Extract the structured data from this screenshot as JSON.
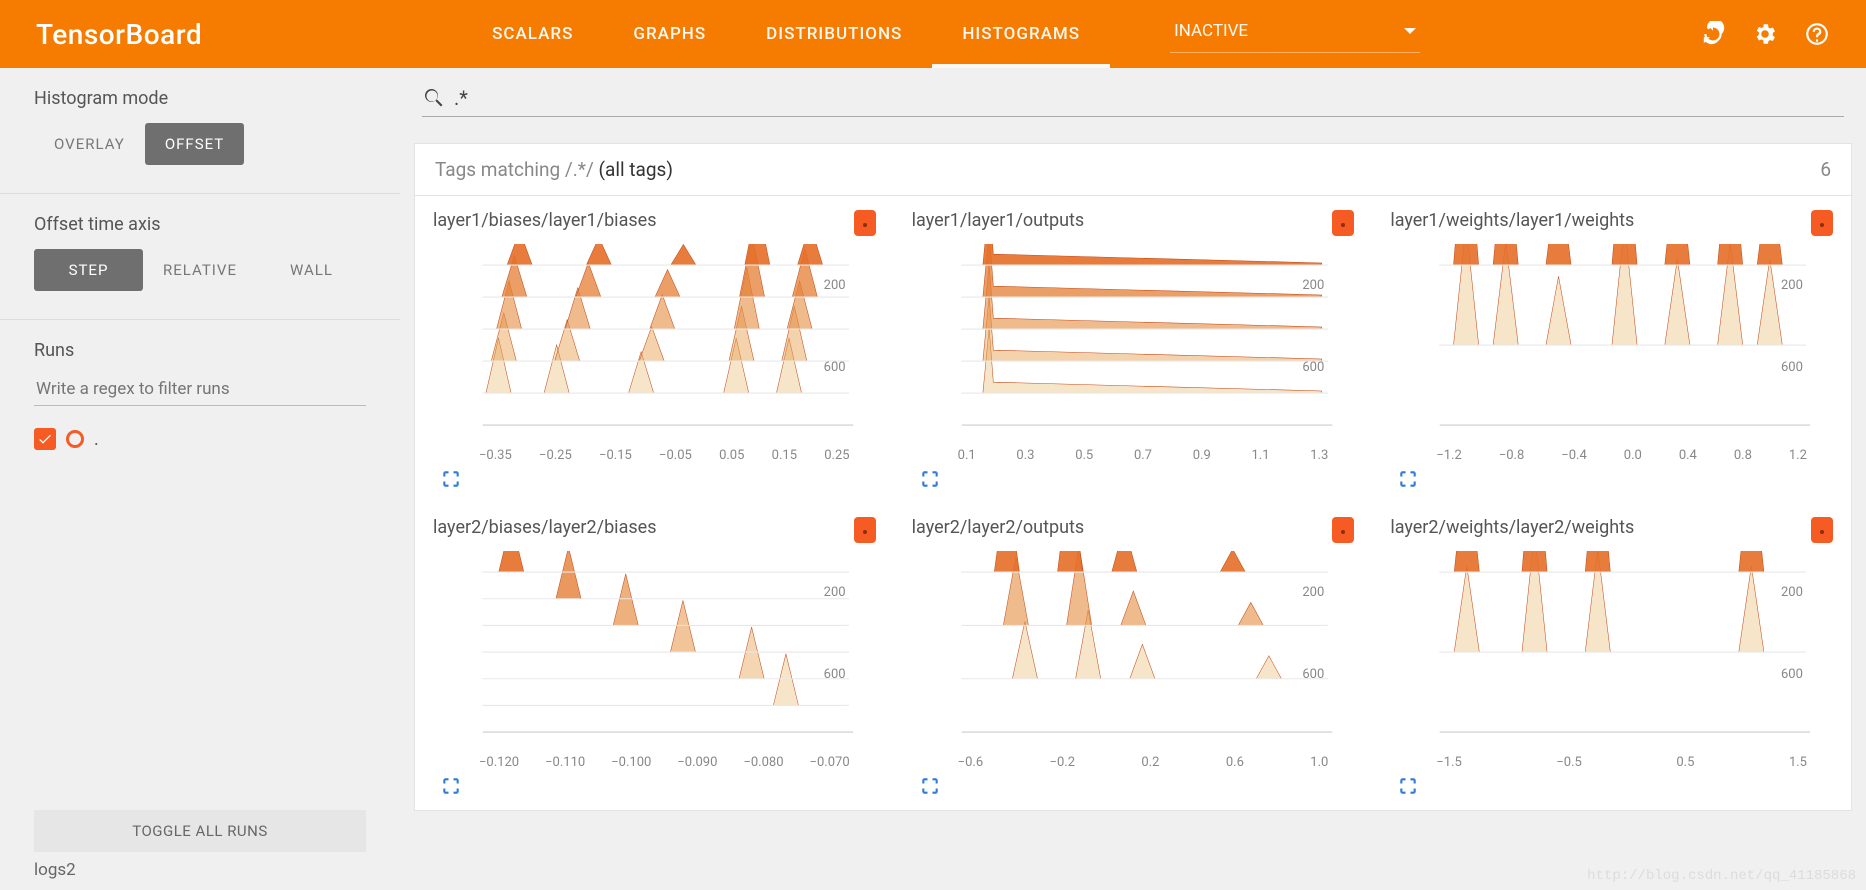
{
  "app_title": "TensorBoard",
  "nav": {
    "tabs": [
      "SCALARS",
      "GRAPHS",
      "DISTRIBUTIONS",
      "HISTOGRAMS"
    ],
    "active_index": 3,
    "inactive_label": "INACTIVE"
  },
  "sidebar": {
    "histogram_mode": {
      "title": "Histogram mode",
      "options": [
        "OVERLAY",
        "OFFSET"
      ],
      "active_index": 1
    },
    "offset_axis": {
      "title": "Offset time axis",
      "options": [
        "STEP",
        "RELATIVE",
        "WALL"
      ],
      "active_index": 0
    },
    "runs": {
      "title": "Runs",
      "placeholder": "Write a regex to filter runs",
      "run_label": "."
    },
    "toggle_all": "TOGGLE ALL RUNS",
    "logs_label": "logs2"
  },
  "search": {
    "value": ".*"
  },
  "tags_bar": {
    "prefix": "Tags matching /.*/ ",
    "suffix": "(all tags)",
    "count": "6"
  },
  "y_ticks": [
    "200",
    "600"
  ],
  "cards": [
    {
      "title": "layer1/biases/layer1/biases",
      "x_ticks": [
        "−0.35",
        "−0.25",
        "−0.15",
        "−0.05",
        "0.05",
        "0.15",
        "0.25"
      ]
    },
    {
      "title": "layer1/layer1/outputs",
      "x_ticks": [
        "0.1",
        "0.3",
        "0.5",
        "0.7",
        "0.9",
        "1.1",
        "1.3"
      ]
    },
    {
      "title": "layer1/weights/layer1/weights",
      "x_ticks": [
        "−1.2",
        "−0.8",
        "−0.4",
        "0.0",
        "0.4",
        "0.8",
        "1.2"
      ]
    },
    {
      "title": "layer2/biases/layer2/biases",
      "x_ticks": [
        "−0.120",
        "−0.110",
        "−0.100",
        "−0.090",
        "−0.080",
        "−0.070"
      ]
    },
    {
      "title": "layer2/layer2/outputs",
      "x_ticks": [
        "−0.6",
        "−0.2",
        "0.2",
        "0.6",
        "1.0"
      ]
    },
    {
      "title": "layer2/weights/layer2/weights",
      "x_ticks": [
        "−1.5",
        "−0.5",
        "0.5",
        "1.5"
      ]
    }
  ],
  "watermark": "http://blog.csdn.net/qq_41185868",
  "chart_data": [
    {
      "type": "histogram-offset",
      "title": "layer1/biases/layer1/biases",
      "x_range": [
        -0.4,
        0.25
      ],
      "y_axis": "step",
      "y_ticks": [
        200,
        600
      ],
      "series": [
        {
          "step": 0,
          "peaks": [
            [
              -0.33,
              0.5
            ],
            [
              -0.18,
              0.4
            ],
            [
              -0.02,
              0.3
            ],
            [
              0.12,
              0.9
            ],
            [
              0.22,
              0.6
            ]
          ]
        },
        {
          "step": 200,
          "peaks": [
            [
              -0.34,
              0.6
            ],
            [
              -0.2,
              0.5
            ],
            [
              -0.05,
              0.4
            ],
            [
              0.11,
              0.9
            ],
            [
              0.21,
              0.7
            ]
          ]
        },
        {
          "step": 400,
          "peaks": [
            [
              -0.35,
              0.7
            ],
            [
              -0.22,
              0.6
            ],
            [
              -0.06,
              0.5
            ],
            [
              0.1,
              0.9
            ],
            [
              0.2,
              0.7
            ]
          ]
        },
        {
          "step": 600,
          "peaks": [
            [
              -0.36,
              0.7
            ],
            [
              -0.24,
              0.6
            ],
            [
              -0.08,
              0.5
            ],
            [
              0.09,
              0.8
            ],
            [
              0.19,
              0.8
            ]
          ]
        },
        {
          "step": 800,
          "peaks": [
            [
              -0.37,
              0.8
            ],
            [
              -0.26,
              0.7
            ],
            [
              -0.1,
              0.6
            ],
            [
              0.08,
              0.8
            ],
            [
              0.18,
              0.8
            ]
          ]
        }
      ]
    },
    {
      "type": "histogram-offset",
      "title": "layer1/layer1/outputs",
      "x_range": [
        0.0,
        1.4
      ],
      "y_axis": "step",
      "y_ticks": [
        200,
        600
      ],
      "series": [
        {
          "step": 0,
          "density_shape": "narrow-spike-near-0.08-then-flat"
        },
        {
          "step": 200,
          "density_shape": "spike-near-0.10-tail-to-1.3"
        },
        {
          "step": 400,
          "density_shape": "spike-near-0.12-tail"
        },
        {
          "step": 600,
          "density_shape": "spike-near-0.14-tail"
        },
        {
          "step": 800,
          "density_shape": "spike-near-0.16-tail"
        }
      ]
    },
    {
      "type": "histogram-offset",
      "title": "layer1/weights/layer1/weights",
      "x_range": [
        -1.3,
        1.3
      ],
      "y_axis": "step",
      "y_ticks": [
        200,
        600
      ],
      "series": [
        {
          "step": 0,
          "peaks": [
            [
              -1.1,
              0.9
            ],
            [
              -0.8,
              0.8
            ],
            [
              -0.4,
              0.6
            ],
            [
              0.1,
              0.9
            ],
            [
              0.5,
              0.7
            ],
            [
              0.9,
              0.8
            ],
            [
              1.2,
              0.6
            ]
          ]
        },
        {
          "step": 800,
          "peaks": [
            [
              -1.1,
              0.7
            ],
            [
              -0.8,
              0.6
            ],
            [
              -0.4,
              0.4
            ],
            [
              0.1,
              0.7
            ],
            [
              0.5,
              0.5
            ],
            [
              0.9,
              0.6
            ],
            [
              1.2,
              0.5
            ]
          ]
        }
      ]
    },
    {
      "type": "histogram-offset",
      "title": "layer2/biases/layer2/biases",
      "x_range": [
        -0.125,
        -0.065
      ],
      "y_axis": "step",
      "y_ticks": [
        200,
        600
      ],
      "series": [
        {
          "step": 0,
          "peaks": [
            [
              -0.12,
              0.9
            ]
          ]
        },
        {
          "step": 200,
          "peaks": [
            [
              -0.11,
              0.9
            ]
          ]
        },
        {
          "step": 400,
          "peaks": [
            [
              -0.1,
              0.9
            ]
          ]
        },
        {
          "step": 600,
          "peaks": [
            [
              -0.09,
              0.9
            ]
          ]
        },
        {
          "step": 800,
          "peaks": [
            [
              -0.078,
              0.9
            ]
          ]
        },
        {
          "step": 999,
          "peaks": [
            [
              -0.072,
              0.9
            ]
          ]
        }
      ]
    },
    {
      "type": "histogram-offset",
      "title": "layer2/layer2/outputs",
      "x_range": [
        -0.8,
        1.1
      ],
      "y_axis": "step",
      "y_ticks": [
        200,
        600
      ],
      "series": [
        {
          "step": 0,
          "peaks": [
            [
              -0.55,
              0.8
            ],
            [
              -0.2,
              0.9
            ],
            [
              0.1,
              0.4
            ],
            [
              0.7,
              0.2
            ]
          ]
        },
        {
          "step": 400,
          "peaks": [
            [
              -0.5,
              0.6
            ],
            [
              -0.15,
              0.7
            ],
            [
              0.15,
              0.3
            ],
            [
              0.8,
              0.2
            ]
          ]
        },
        {
          "step": 800,
          "peaks": [
            [
              -0.45,
              0.5
            ],
            [
              -0.1,
              0.6
            ],
            [
              0.2,
              0.3
            ],
            [
              0.9,
              0.2
            ]
          ]
        }
      ]
    },
    {
      "type": "histogram-offset",
      "title": "layer2/weights/layer2/weights",
      "x_range": [
        -1.9,
        1.9
      ],
      "y_axis": "step",
      "y_ticks": [
        200,
        600
      ],
      "series": [
        {
          "step": 0,
          "peaks": [
            [
              -1.6,
              0.7
            ],
            [
              -0.85,
              0.9
            ],
            [
              -0.15,
              0.8
            ],
            [
              1.55,
              0.7
            ]
          ]
        },
        {
          "step": 800,
          "peaks": [
            [
              -1.6,
              0.5
            ],
            [
              -0.85,
              0.7
            ],
            [
              -0.15,
              0.6
            ],
            [
              1.55,
              0.5
            ]
          ]
        }
      ]
    }
  ]
}
